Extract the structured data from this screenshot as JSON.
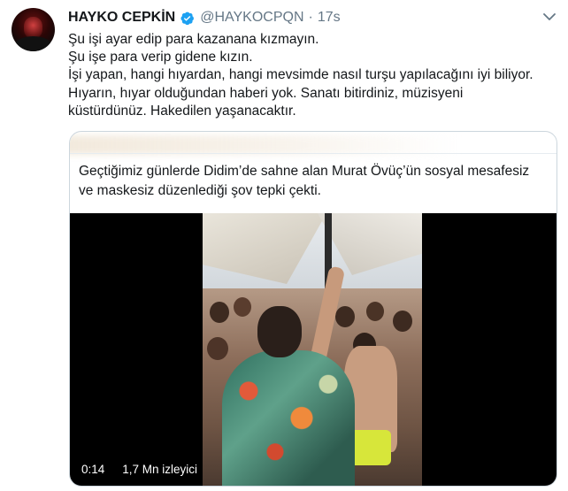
{
  "tweet": {
    "display_name": "HAYKO CEPKİN",
    "handle": "@HAYKOCPQN",
    "separator": "·",
    "time": "17s",
    "lines": [
      "Şu işi ayar edip para kazanana kızmayın.",
      "Şu işe para verip gidene kızın.",
      "İşi yapan, hangi hıyardan, hangi mevsimde nasıl turşu yapılacağını iyi biliyor.",
      "Hıyarın, hıyar olduğundan haberi yok. Sanatı bitirdiniz, müzisyeni",
      "küstürdünüz. Hakedilen yaşanacaktır."
    ]
  },
  "quoted": {
    "lines": [
      "Geçtiğimiz günlerde Didim’de sahne alan Murat Övüç’ün sosyal mesafesiz",
      "ve maskesiz düzenlediği şov tepki çekti."
    ],
    "video": {
      "duration": "0:14",
      "views": "1,7 Mn izleyici"
    }
  },
  "colors": {
    "text": "#14171a",
    "secondary": "#657786",
    "verified": "#1da1f2",
    "border": "#ccd6dd"
  },
  "icons": {
    "verified": "verified-badge-icon",
    "menu": "chevron-down-icon"
  }
}
